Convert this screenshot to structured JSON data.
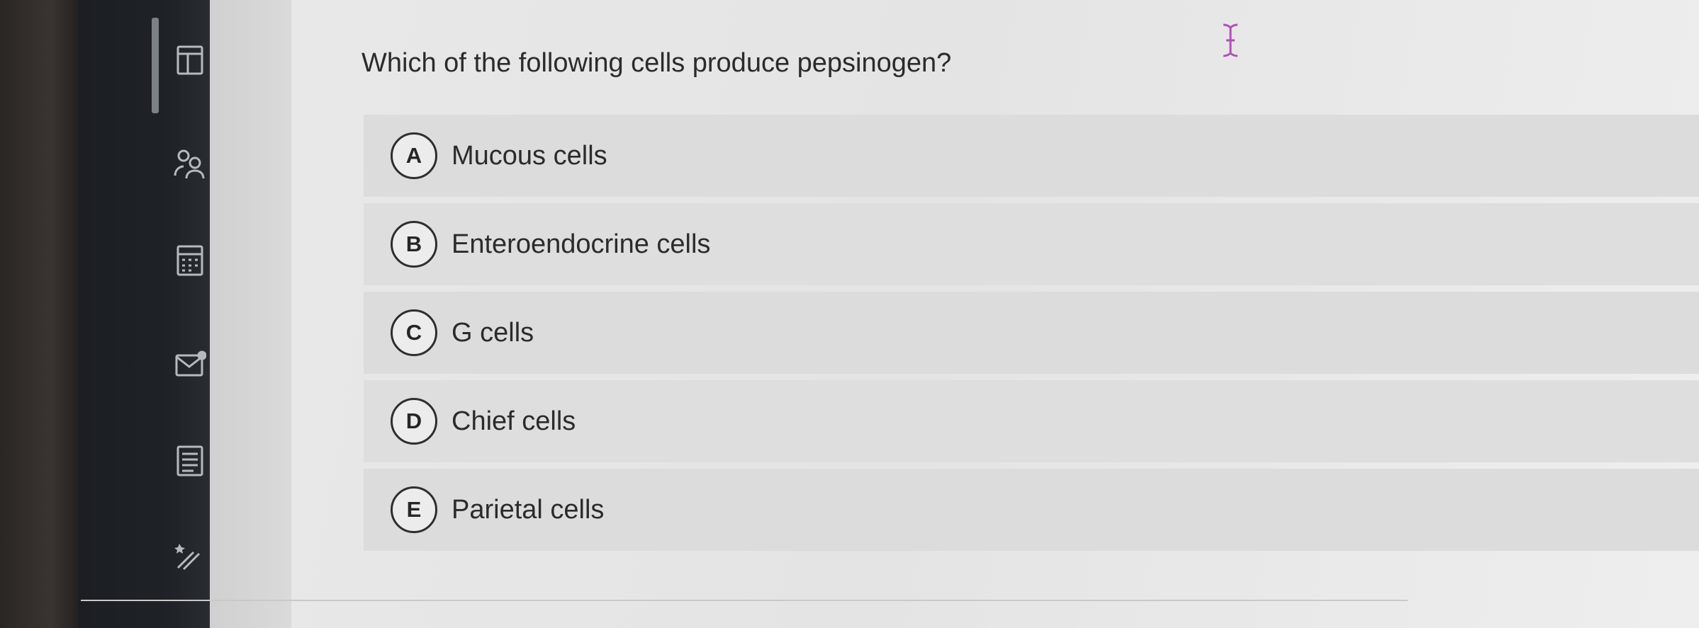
{
  "question": {
    "text": "Which of the following cells produce pepsinogen?"
  },
  "options": [
    {
      "letter": "A",
      "text": "Mucous cells"
    },
    {
      "letter": "B",
      "text": "Enteroendocrine cells"
    },
    {
      "letter": "C",
      "text": "G cells"
    },
    {
      "letter": "D",
      "text": "Chief cells"
    },
    {
      "letter": "E",
      "text": "Parietal cells"
    }
  ],
  "sidebar": {
    "icons": [
      "document-icon",
      "people-icon",
      "calculator-icon",
      "mail-icon",
      "notes-icon",
      "tools-icon"
    ]
  },
  "colors": {
    "sidebar": "#1f2328",
    "content_background": "#e6e6e6",
    "option_background": "#dedede",
    "cursor": "#b24fb8"
  }
}
